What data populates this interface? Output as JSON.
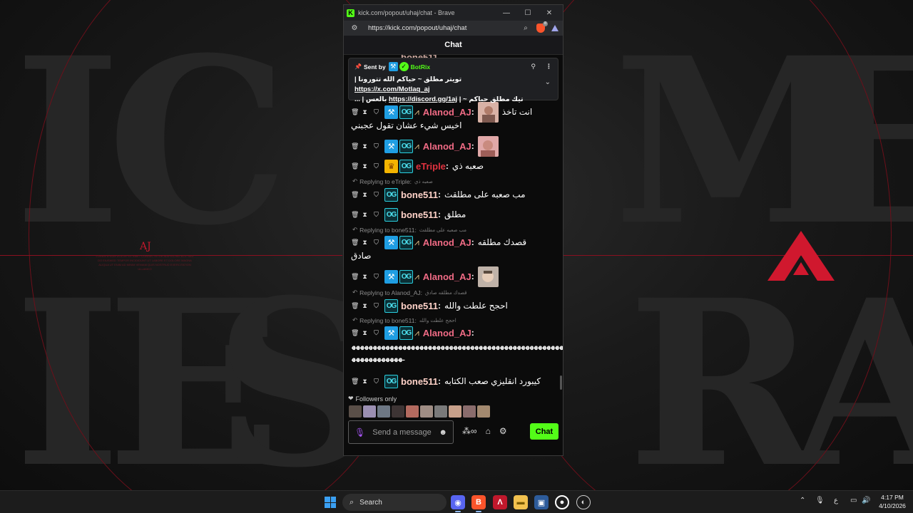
{
  "browser": {
    "title": "kick.com/popout/uhaj/chat - Brave",
    "url": "https://kick.com/popout/uhaj/chat",
    "favicon": "K",
    "brave_badge": "8",
    "minimize": "—",
    "maximize": "☐",
    "close": "✕"
  },
  "chat": {
    "header": "Chat",
    "pinned": {
      "sent_by": "Sent by",
      "author": "BotRix",
      "line1_text": "تويتر مطلق ~ حياكم الله تتورونا |",
      "line1_link": "https://x.com/Motlaq_aj",
      "line2_text": "تيك مطلق حياكم ~ |",
      "line2_link": "https://discord.gg/1aj",
      "line2_end": "بالعس | ...",
      "pin_icon": "pin-icon",
      "more_icon": "⋮",
      "chevron": "⌄"
    },
    "messages": [
      {
        "user": "Alanod_AJ",
        "text": "انت تاخذ",
        "cont": "اخيس شيء عشان تقول عجبني"
      },
      {
        "user": "Alanod_AJ",
        "text": ""
      },
      {
        "user": "eTriple",
        "text": "صعبه ذي"
      },
      {
        "user": "bone511",
        "text": "مب صعبه على مطلقث",
        "reply_to": "Replying to eTriple:",
        "reply_quote": "صعبه ذي"
      },
      {
        "user": "bone511",
        "text": "مطلق"
      },
      {
        "user": "Alanod_AJ",
        "text": "قصدك مطلقه",
        "cont": "صادق",
        "reply_to": "Replying to bone511:",
        "reply_quote": "مب صعبه على مطلقث"
      },
      {
        "user": "Alanod_AJ",
        "text": ""
      },
      {
        "user": "bone511",
        "text": "احجح علطت والله",
        "reply_to": "Replying to Alanod_AJ:",
        "reply_quote": "قصدك مطلقه صادق"
      },
      {
        "user": "Alanod_AJ",
        "text": "",
        "reply_to": "Replying to bone511:",
        "reply_quote": "احجح علطت والله",
        "spam1": "ـﻬﻬﻬﻬﻬﻬﻬﻬﻬﻬﻬﻬﻬﻬﻬﻬﻬﻬﻬﻬﻬﻬﻬﻬﻬﻬﻬﻬﻬﻬﻬﻬﻬﻬﻬﻬﻬﻬﻬﻬﻬﻬﻬﻬﻬﻬﻬﻬﻬﻬ",
        "spam2": "ـﻬﻬﻬﻬﻬﻬﻬﻬﻬﻬﻬﻬ"
      },
      {
        "user": "bone511",
        "text": "كيبورد انقليزي صعب الكتابه"
      }
    ],
    "followers_only": "Followers only",
    "input_placeholder": "Send a message",
    "send_button": "Chat",
    "colon": ":"
  },
  "wallpaper": {
    "aj": "AJ",
    "tiny": "LOREM IPSUM DOLOR SIT AMET CONSECTETUR ADIPISCING ELIT SED DO EIUSMOD TEMPOR INCIDIDUNT UT LABORE ET DOLORE MAGNA ALIQUA UT ENIM AD MINIM VENIAM QUIS NOSTRUD EXERCITATION ULLAMCO"
  },
  "taskbar": {
    "search": "Search",
    "time": "4:17 PM",
    "date": "4/10/2026",
    "lang": "ع"
  },
  "colors": {
    "kick_green": "#53fc18",
    "alanod": "#f06b85",
    "etriple": "#e1323f",
    "bone": "#ffd2c8",
    "accent_red": "#c0182c"
  }
}
